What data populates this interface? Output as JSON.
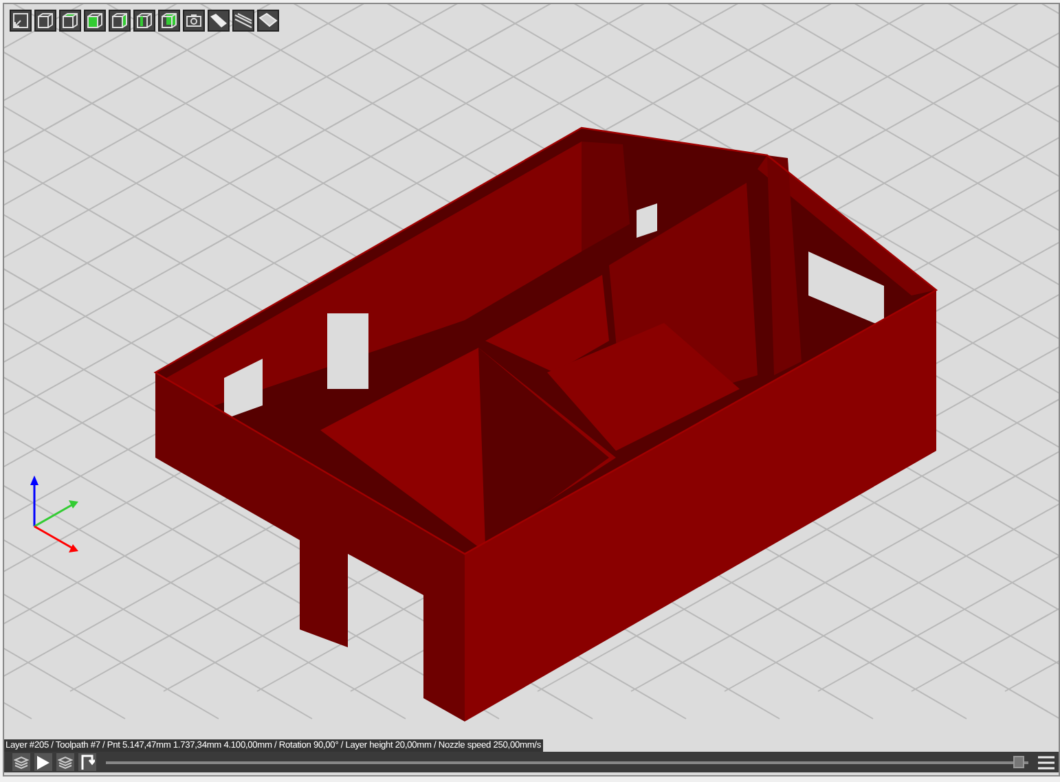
{
  "viewport": {
    "status_text": "Layer #205 / Toolpath #7 / Pnt 5.147,47mm 1.737,34mm 4.100,00mm / Rotation 90,00° / Layer height 20,00mm / Nozzle speed 250,00mm/s"
  },
  "playback": {
    "layer_slider": {
      "level": 0.99
    }
  }
}
